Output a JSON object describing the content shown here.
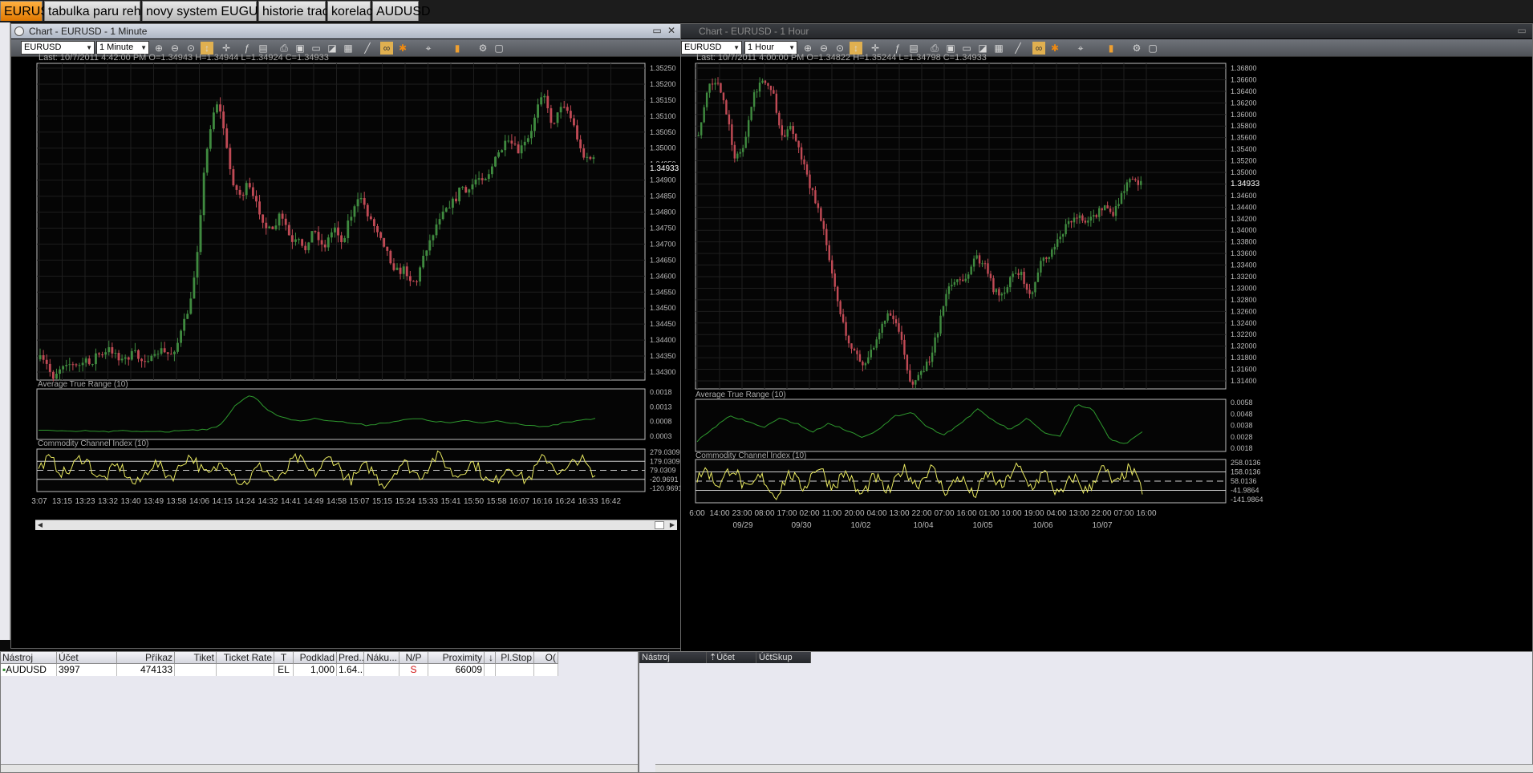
{
  "workspace_tabs": [
    {
      "label": "EURUSD",
      "active": true
    },
    {
      "label": "tabulka paru rehled",
      "active": false
    },
    {
      "label": "novy system EUGUUCH",
      "active": false
    },
    {
      "label": "historie tradu",
      "active": false
    },
    {
      "label": "korelace",
      "active": false
    },
    {
      "label": "AUDUSD",
      "active": false
    }
  ],
  "chart_left": {
    "title": "Chart - EURUSD - 1 Minute",
    "instrument": "EURUSD",
    "timeframe": "1 Minute",
    "info_line": "Last: 10/7/2011 4:42:00 PM O=1.34943 H=1.34944 L=1.34924 C=1.34933",
    "last_price_label": "1.34933",
    "price_ticks": [
      "1.35250",
      "1.35200",
      "1.35150",
      "1.35100",
      "1.35050",
      "1.35000",
      "1.34950",
      "1.34900",
      "1.34850",
      "1.34800",
      "1.34750",
      "1.34700",
      "1.34650",
      "1.34600",
      "1.34550",
      "1.34500",
      "1.34450",
      "1.34400",
      "1.34350",
      "1.34300"
    ],
    "atr_label": "Average True Range (10)",
    "atr_ticks": [
      "0.0018",
      "0.0013",
      "0.0008",
      "0.0003"
    ],
    "cci_label": "Commodity Channel Index (10)",
    "cci_ticks": [
      "279.0309",
      "179.0309",
      "79.0309",
      "-20.9691",
      "-120.9691"
    ],
    "time_ticks": [
      "3:07",
      "13:15",
      "13:23",
      "13:32",
      "13:40",
      "13:49",
      "13:58",
      "14:06",
      "14:15",
      "14:24",
      "14:32",
      "14:41",
      "14:49",
      "14:58",
      "15:07",
      "15:15",
      "15:24",
      "15:33",
      "15:41",
      "15:50",
      "15:58",
      "16:07",
      "16:16",
      "16:24",
      "16:33",
      "16:42"
    ]
  },
  "chart_right": {
    "title": "Chart - EURUSD - 1 Hour",
    "instrument": "EURUSD",
    "timeframe": "1 Hour",
    "info_line": "Last: 10/7/2011 4:00:00 PM O=1.34822 H=1.35244 L=1.34798 C=1.34933",
    "last_price_label": "1.34933",
    "price_ticks": [
      "1.36800",
      "1.36600",
      "1.36400",
      "1.36200",
      "1.36000",
      "1.35800",
      "1.35600",
      "1.35400",
      "1.35200",
      "1.35000",
      "1.34800",
      "1.34600",
      "1.34400",
      "1.34200",
      "1.34000",
      "1.33800",
      "1.33600",
      "1.33400",
      "1.33200",
      "1.33000",
      "1.32800",
      "1.32600",
      "1.32400",
      "1.32200",
      "1.32000",
      "1.31800",
      "1.31600",
      "1.31400"
    ],
    "atr_label": "Average True Range (10)",
    "atr_ticks": [
      "0.0058",
      "0.0048",
      "0.0038",
      "0.0028",
      "0.0018"
    ],
    "cci_label": "Commodity Channel Index (10)",
    "cci_ticks": [
      "258.0136",
      "158.0136",
      "58.0136",
      "-41.9864",
      "-141.9864"
    ],
    "time_ticks": [
      "6:00",
      "14:00",
      "23:00",
      "08:00",
      "17:00",
      "02:00",
      "11:00",
      "20:00",
      "04:00",
      "13:00",
      "22:00",
      "07:00",
      "16:00",
      "01:00",
      "10:00",
      "19:00",
      "04:00",
      "13:00",
      "22:00",
      "07:00",
      "16:00"
    ],
    "date_ticks": [
      "09/29",
      "09/30",
      "10/02",
      "10/04",
      "10/05",
      "10/06",
      "10/07"
    ]
  },
  "orders_table": {
    "columns": [
      "Nástroj",
      "Účet",
      "Příkaz",
      "Tiket",
      "Ticket Rate",
      "T",
      "Podklad",
      "Pred...",
      "Náku...",
      "N/P",
      "Proximity",
      "",
      "Pl.Stop",
      "O("
    ],
    "rows": [
      {
        "instrument": "AUDUSD",
        "account": "3997",
        "order": "474133",
        "ticket": "",
        "ticket_rate": "",
        "type": "EL",
        "underlying": "1,000",
        "pred": "1.64...",
        "buy": "",
        "np": "S",
        "proximity": "66009",
        "pl_stop": "",
        "o": ""
      }
    ]
  },
  "positions_table": {
    "columns": [
      "Nástroj",
      "Účet",
      "ÚčtSkup"
    ]
  },
  "colors": {
    "bull": "#3f8a3f",
    "bear": "#c04a55",
    "atr_line": "#2e9a2e",
    "cci_line": "#e8e860",
    "active_tab": "#f08a10"
  }
}
